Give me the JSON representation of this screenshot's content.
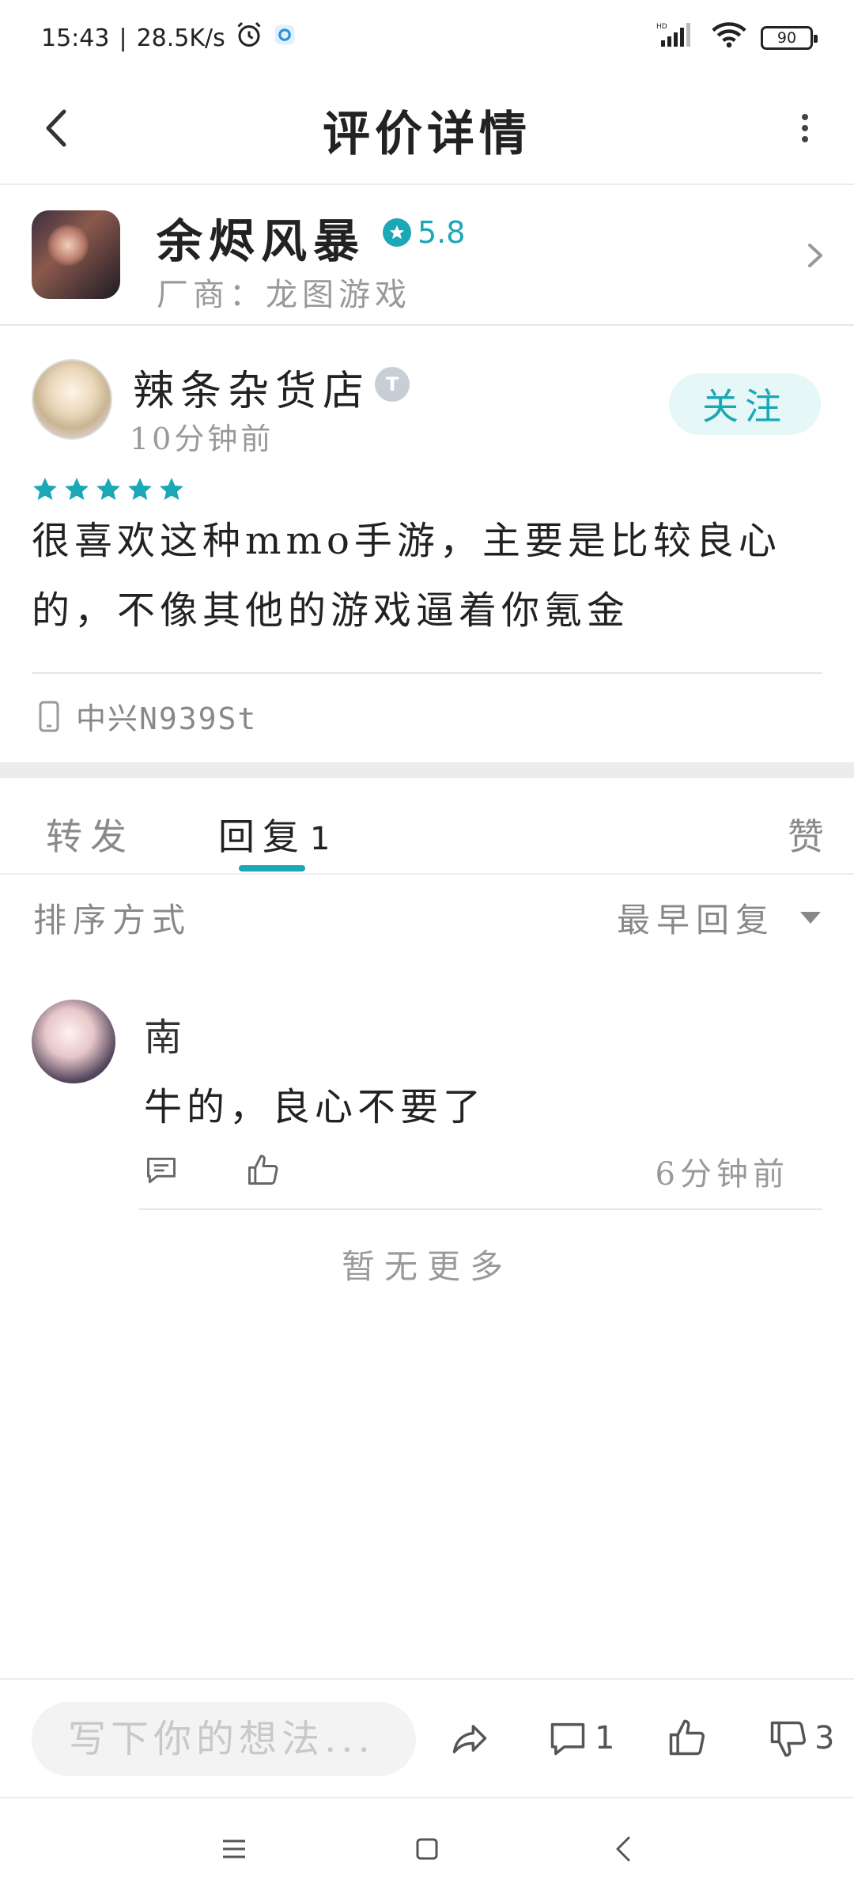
{
  "status_bar": {
    "time": "15:43",
    "net_speed": "28.5K/s",
    "battery": "90"
  },
  "header": {
    "title": "评价详情"
  },
  "game": {
    "name": "余烬风暴",
    "rating": "5.8",
    "vendor": "厂商：龙图游戏"
  },
  "review": {
    "user_name": "辣条杂货店",
    "level_badge": "T",
    "time": "10分钟前",
    "follow_label": "关注",
    "stars": 5,
    "text_line1": "很喜欢这种mmo手游，主要是比较良心",
    "text_line2": "的，不像其他的游戏逼着你氪金",
    "device": "中兴N939St"
  },
  "tabs": {
    "forward": "转发",
    "reply": "回复",
    "reply_count": "1",
    "like": "赞"
  },
  "sort": {
    "label": "排序方式",
    "value": "最早回复"
  },
  "replies": [
    {
      "name": "南",
      "text": "牛的，良心不要了",
      "time": "6分钟前"
    }
  ],
  "no_more": "暂无更多",
  "action_bar": {
    "input_placeholder": "写下你的想法...",
    "comment_count": "1",
    "dislike_count": "3"
  },
  "colors": {
    "accent": "#1aa7b6",
    "follow_bg": "#e6f7f8"
  }
}
